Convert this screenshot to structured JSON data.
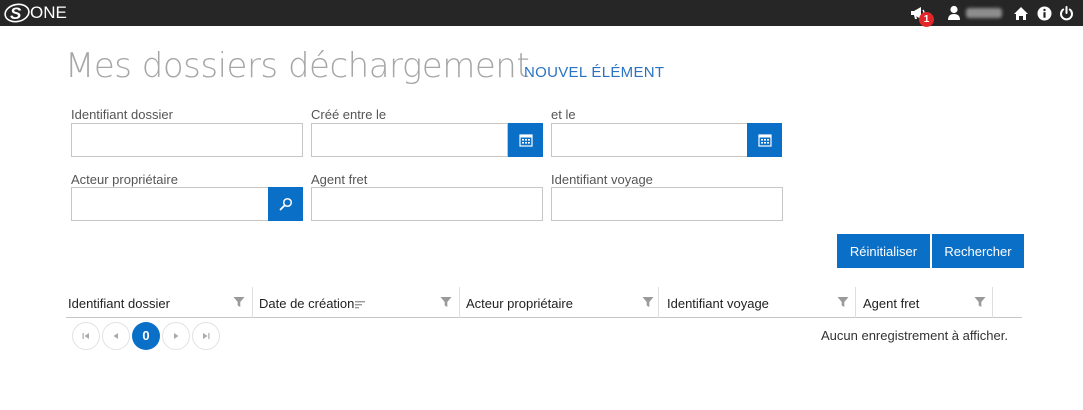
{
  "app": {
    "logo_text": "ONE",
    "notification_count": "1"
  },
  "icons": {
    "megaphone": "megaphone-icon",
    "user": "user-icon",
    "home": "home-icon",
    "info": "info-icon",
    "power": "power-icon",
    "calendar": "calendar-icon",
    "search": "search-icon",
    "filter": "filter-icon",
    "sort": "sort-icon"
  },
  "colors": {
    "topbar": "#262626",
    "accent": "#0a6fc7",
    "link": "#2a72c4",
    "title": "#a6a6a6",
    "badge": "#e3262a"
  },
  "header": {
    "title": "Mes dossiers déchargement",
    "new_item_link": "NOUVEL ÉLÉMENT"
  },
  "form": {
    "fields": {
      "dossier_id": {
        "label": "Identifiant dossier",
        "value": ""
      },
      "created_from": {
        "label": "Créé entre le",
        "value": ""
      },
      "created_to": {
        "label": "et le",
        "value": ""
      },
      "owner": {
        "label": "Acteur propriétaire",
        "value": ""
      },
      "freight_agent": {
        "label": "Agent fret",
        "value": ""
      },
      "voyage_id": {
        "label": "Identifiant voyage",
        "value": ""
      }
    },
    "reset_label": "Réinitialiser",
    "search_label": "Rechercher"
  },
  "grid": {
    "columns": [
      {
        "label": "Identifiant dossier"
      },
      {
        "label": "Date de création"
      },
      {
        "label": "Acteur propriétaire"
      },
      {
        "label": "Identifiant voyage"
      },
      {
        "label": "Agent fret"
      }
    ],
    "rows": [],
    "pager": {
      "current_page": "0"
    },
    "empty_message": "Aucun enregistrement à afficher."
  }
}
